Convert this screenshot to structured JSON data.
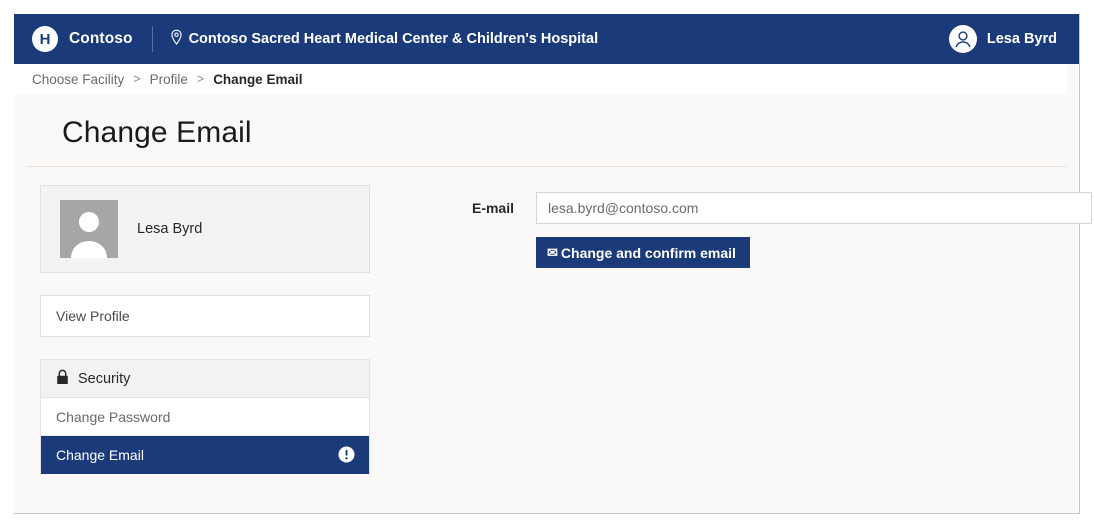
{
  "navbar": {
    "brand_mark": "H",
    "brand_mark_icon": "contoso-logo-icon",
    "brand_name": "Contoso",
    "pin_icon": "location-pin-icon",
    "facility_name": "Contoso Sacred Heart Medical Center & Children's Hospital",
    "user_avatar_icon": "user-avatar-icon",
    "user_name": "Lesa Byrd",
    "background_color": "#1b3a7a"
  },
  "breadcrumb": {
    "items": [
      {
        "label": "Choose Facility",
        "current": false
      },
      {
        "label": "Profile",
        "current": false
      },
      {
        "label": "Change Email",
        "current": true
      }
    ],
    "separator": ">"
  },
  "page": {
    "title": "Change Email",
    "background_color": "#faf9f8"
  },
  "sidebar": {
    "profile_card": {
      "photo_icon": "person-placeholder-icon",
      "name": "Lesa Byrd"
    },
    "view_profile": {
      "label": "View Profile"
    },
    "security_group": {
      "header_label": "Security",
      "header_icon": "lock-icon",
      "items": [
        {
          "label": "Change Password",
          "active": false
        },
        {
          "label": "Change Email",
          "active": true,
          "badge_icon": "info-exclamation-icon"
        }
      ]
    }
  },
  "form": {
    "email_label": "E-mail",
    "email_value": "",
    "email_placeholder": "lesa.byrd@contoso.com",
    "submit_button": {
      "icon": "envelope-icon",
      "glyph": "✉",
      "label": "Change and confirm email",
      "color": "#1b3a7a"
    }
  }
}
